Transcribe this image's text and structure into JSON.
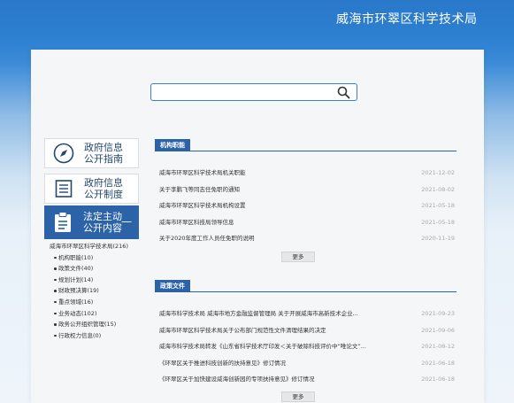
{
  "header": {
    "title": "威海市环翠区科学技术局"
  },
  "search": {
    "placeholder": ""
  },
  "sidebar": {
    "cards": [
      {
        "label": "政府信息\n公开指南",
        "icon": "compass-icon"
      },
      {
        "label": "政府信息\n公开制度",
        "icon": "document-list-icon"
      }
    ],
    "active": {
      "label": "法定主动\n公开内容",
      "icon": "clipboard-icon",
      "toggle": "—"
    },
    "tree": {
      "root": "威海市环翠区科学技术局(216)",
      "children": [
        "机构职能(10)",
        "政策文件(40)",
        "规划计划(14)",
        "财政预决算(19)",
        "重点领域(16)",
        "业务动态(102)",
        "政务公开组织管理(15)",
        "行政权力信息(0)"
      ]
    }
  },
  "sections": [
    {
      "title": "机构职能",
      "items": [
        {
          "title": "威海市环翠区科学技术局机关职能",
          "date": "2021-12-02"
        },
        {
          "title": "关于李鹏飞等同志任免职的通知",
          "date": "2021-08-02"
        },
        {
          "title": "威海市环翠区科学技术局机构设置",
          "date": "2021-05-18"
        },
        {
          "title": "威海市环翠区科技局领导信息",
          "date": "2021-05-18"
        },
        {
          "title": "关于2020年度工作人员任免职的说明",
          "date": "2020-11-19"
        }
      ],
      "more": "更多"
    },
    {
      "title": "政策文件",
      "items": [
        {
          "title": "威海市科学技术局 威海市地方金融监督管理局 关于开展威海市高新技术企业...",
          "date": "2021-09-23"
        },
        {
          "title": "威海市环翠区科学技术局关于公布部门规范性文件清理结果的决定",
          "date": "2021-09-06"
        },
        {
          "title": "威海市科学技术局转发《山东省科学技术厅印发＜关于破除科技评价中“唯论文”...",
          "date": "2021-08-12"
        },
        {
          "title": "《环翠区关于推进科技创新的扶持意见》修订情况",
          "date": "2021-06-18"
        },
        {
          "title": "《环翠区关于加快建设威海创新园的专项扶持意见》修订情况",
          "date": "2021-06-18"
        }
      ],
      "more": "更多"
    }
  ]
}
